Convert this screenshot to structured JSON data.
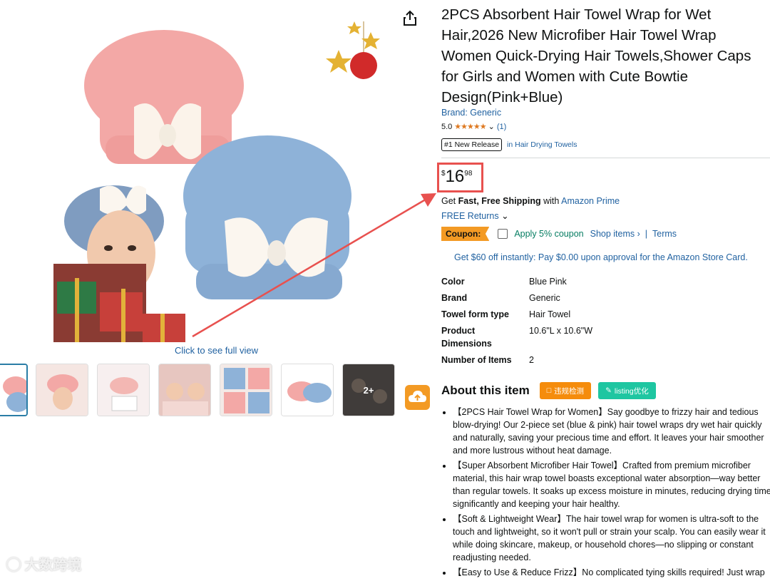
{
  "product": {
    "title": "2PCS Absorbent Hair Towel Wrap for Wet Hair,2026 New Microfiber Hair Towel Wrap Women Quick-Drying Hair Towels,Shower Caps for Girls and Women with Cute Bowtie Design(Pink+Blue)",
    "brand_link": "Brand: Generic",
    "rating_value": "5.0",
    "stars": "★★★★★",
    "rating_count": "(1)",
    "badge": "#1 New Release",
    "badge_category": "in Hair Drying Towels"
  },
  "price": {
    "symbol": "$",
    "whole": "16",
    "fraction": "98"
  },
  "shipping": {
    "prefix": "Get ",
    "bold": "Fast, Free Shipping",
    "mid": " with ",
    "link": "Amazon Prime"
  },
  "returns": "FREE Returns",
  "coupon": {
    "label": "Coupon:",
    "apply": "Apply 5% coupon",
    "shop": "Shop items ›",
    "sep": "|",
    "terms": "Terms"
  },
  "promo": "Get $60 off instantly: Pay $0.00 upon approval for the Amazon Store Card.",
  "specs": [
    {
      "key": "Color",
      "value": "Blue Pink"
    },
    {
      "key": "Brand",
      "value": "Generic"
    },
    {
      "key": "Towel form type",
      "value": "Hair Towel"
    },
    {
      "key": "Product Dimensions",
      "value": "10.6\"L x 10.6\"W"
    },
    {
      "key": "Number of Items",
      "value": "2"
    }
  ],
  "about": {
    "title": "About this item",
    "btn_violation": "违规检测",
    "btn_listing": "listing优化",
    "bullets": [
      "【2PCS Hair Towel Wrap for Women】Say goodbye to frizzy hair and tedious blow-drying! Our 2-piece set (blue & pink) hair towel wraps dry wet hair quickly and naturally, saving your precious time and effort. It leaves your hair smoother and more lustrous without heat damage.",
      "【Super Absorbent Microfiber Hair Towel】Crafted from premium microfiber material, this hair wrap towel boasts exceptional water absorption—way better than regular towels. It soaks up excess moisture in minutes, reducing drying time significantly and keeping your hair healthy.",
      "【Soft & Lightweight Wear】The hair towel wrap for women is ultra-soft to the touch and lightweight, so it won't pull or strain your scalp. You can easily wear it while doing skincare, makeup, or household chores—no slipping or constant readjusting needed.",
      "【Easy to Use & Reduce Frizz】No complicated tying skills required! Just wrap"
    ]
  },
  "gallery": {
    "click_full_view": "Click to see full view",
    "more_label": "2+"
  },
  "watermark": "大数跨境",
  "colors": {
    "accent_red": "#e8514f",
    "link": "#2162a1",
    "coupon": "#f39a24",
    "teal": "#1ec6a1"
  }
}
